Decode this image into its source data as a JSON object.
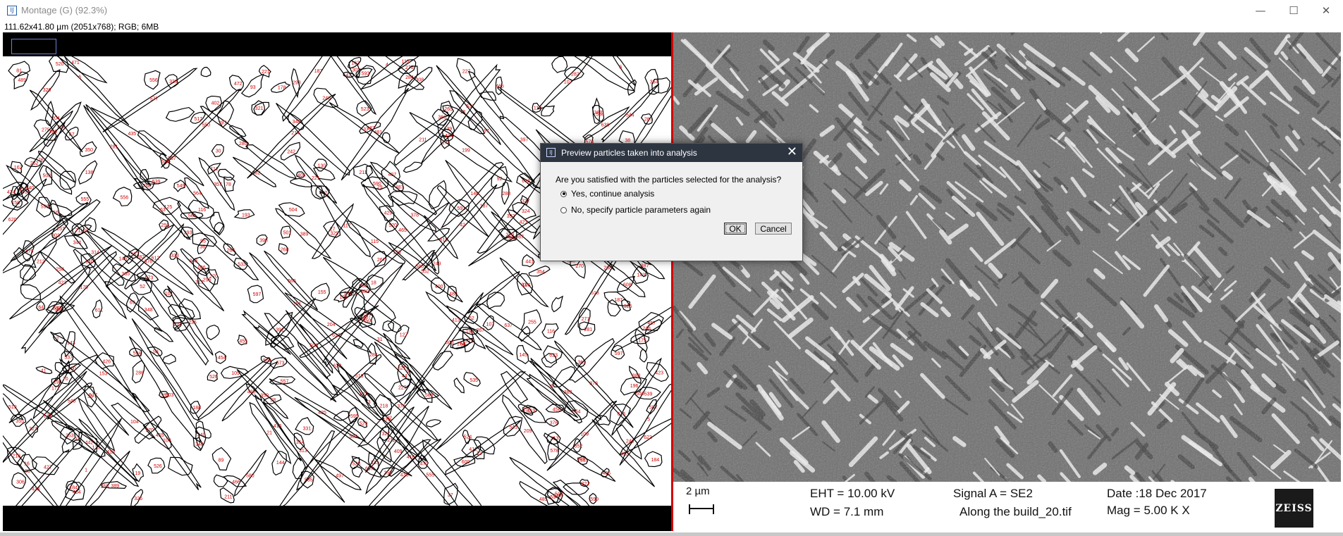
{
  "window": {
    "title": "Montage (G) (92.3%)",
    "app_icon": "imagej-icon",
    "controls": {
      "minimize": "—",
      "maximize": "☐",
      "close": "✕"
    }
  },
  "status_line": "111.62x41.80 µm (2051x768); RGB; 6MB",
  "sem_info": {
    "scale": "2 µm",
    "eht": "EHT = 10.00 kV",
    "wd": "WD =  7.1 mm",
    "signal": "Signal A = SE2",
    "filename": "Along the build_20.tif",
    "date": "Date :18 Dec 2017",
    "mag": "Mag =    5.00 K X",
    "logo": "ZEISS"
  },
  "dialog": {
    "title": "Preview particles taken into analysis",
    "question": "Are you satisfied with the particles selected for the analysis?",
    "options": [
      {
        "label": "Yes, continue analysis",
        "selected": true
      },
      {
        "label": "No, specify particle parameters again",
        "selected": false
      }
    ],
    "ok_label": "OK",
    "cancel_label": "Cancel",
    "close_glyph": "✕"
  },
  "colors": {
    "outline": "#000000",
    "particle_label": "#d00000",
    "divider": "#d40000",
    "dialog_title_bg": "#2d3541"
  }
}
